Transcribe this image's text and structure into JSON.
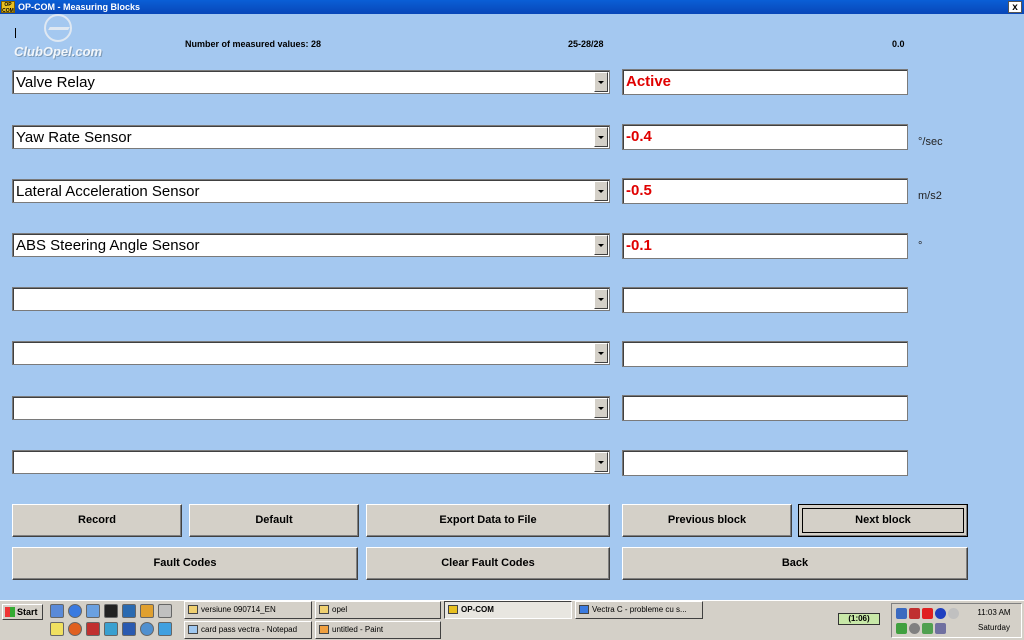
{
  "window": {
    "title": "OP-COM - Measuring Blocks",
    "icon_text": "OP COM",
    "close_symbol": "x"
  },
  "header": {
    "logo_text": "ClubOpel.com",
    "measured_label": "Number of measured values: 28",
    "range": "25-28/28",
    "time": "0.0"
  },
  "rows": [
    {
      "name": "Valve Relay",
      "value": "Active",
      "unit": ""
    },
    {
      "name": "Yaw Rate Sensor",
      "value": "-0.4",
      "unit": "°/sec"
    },
    {
      "name": "Lateral Acceleration Sensor",
      "value": "-0.5",
      "unit": "m/s2"
    },
    {
      "name": "ABS Steering Angle Sensor",
      "value": "-0.1",
      "unit": "°"
    },
    {
      "name": "",
      "value": "",
      "unit": ""
    },
    {
      "name": "",
      "value": "",
      "unit": ""
    },
    {
      "name": "",
      "value": "",
      "unit": ""
    },
    {
      "name": "",
      "value": "",
      "unit": ""
    }
  ],
  "buttons": {
    "record": "Record",
    "default": "Default",
    "export": "Export Data to File",
    "previous": "Previous block",
    "next": "Next block",
    "fault_codes": "Fault Codes",
    "clear_fault_codes": "Clear Fault Codes",
    "back": "Back"
  },
  "taskbar": {
    "start_label": "Start",
    "tasks": [
      "versiune 090714_EN",
      "opel",
      "OP-COM",
      "Vectra C - probleme cu s...",
      "card pass vectra - Notepad",
      "untitled - Paint"
    ],
    "battery": "(1:06)",
    "clock_time": "11:03 AM",
    "clock_day": "Saturday"
  }
}
